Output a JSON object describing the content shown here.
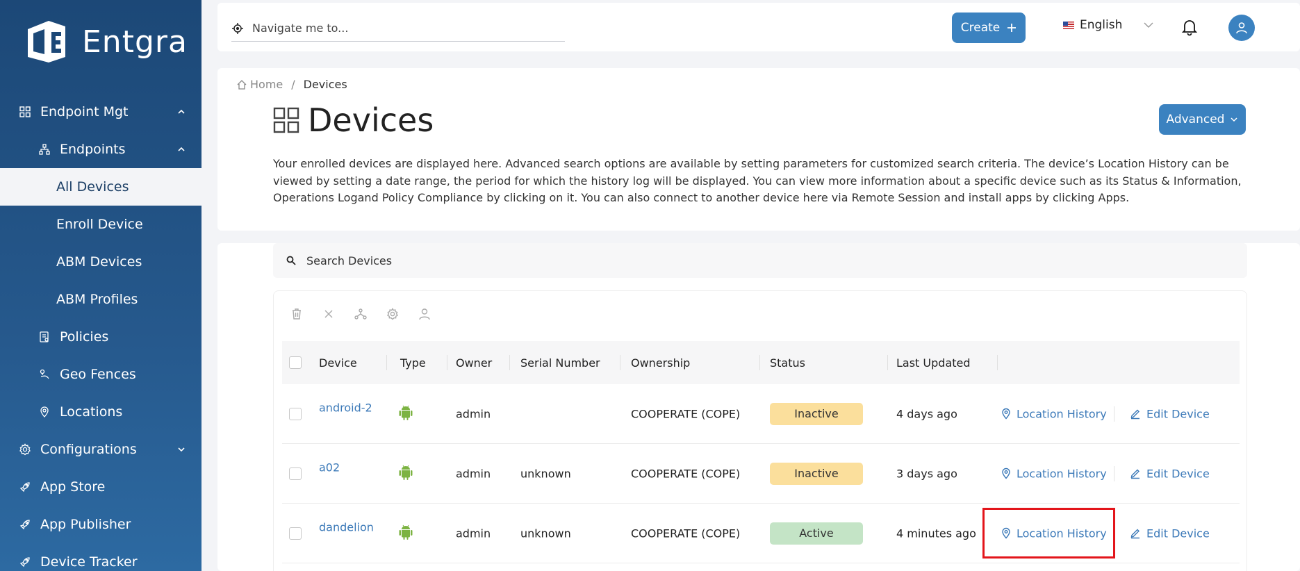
{
  "brand": {
    "name": "Entgra"
  },
  "sidebar": {
    "items": [
      {
        "label": "Endpoint Mgt",
        "icon": "grid-icon",
        "level": 0,
        "expanded": true
      },
      {
        "label": "Endpoints",
        "icon": "hierarchy-icon",
        "level": 1,
        "expanded": true
      },
      {
        "label": "All Devices",
        "level": 2,
        "active": true
      },
      {
        "label": "Enroll Device",
        "level": 2
      },
      {
        "label": "ABM Devices",
        "level": 2
      },
      {
        "label": "ABM Profiles",
        "level": 2
      },
      {
        "label": "Policies",
        "icon": "policy-icon",
        "level": 1
      },
      {
        "label": "Geo Fences",
        "icon": "geofence-icon",
        "level": 1
      },
      {
        "label": "Locations",
        "icon": "location-pin-icon",
        "level": 1
      },
      {
        "label": "Configurations",
        "icon": "gear-icon",
        "level": 0,
        "expanded": false
      },
      {
        "label": "App Store",
        "icon": "rocket-icon",
        "level": 0
      },
      {
        "label": "App Publisher",
        "icon": "rocket-icon",
        "level": 0
      },
      {
        "label": "Device Tracker",
        "icon": "rocket-icon",
        "level": 0
      }
    ]
  },
  "topbar": {
    "nav_placeholder": "Navigate me to...",
    "create_label": "Create",
    "language": "English"
  },
  "breadcrumb": {
    "home": "Home",
    "separator": "/",
    "current": "Devices"
  },
  "page": {
    "title": "Devices",
    "advanced_label": "Advanced",
    "description": "Your enrolled devices are displayed here. Advanced search options are available by setting parameters for customized search criteria. The device’s Location History can be viewed by setting a date range, the period for which the history log will be displayed. You can view more information about a specific device such as its Status & Information, Operations Logand Policy Compliance by clicking on it. You can also connect to another device here via Remote Session and install apps by clicking Apps."
  },
  "search": {
    "placeholder": "Search Devices"
  },
  "table": {
    "headers": {
      "device": "Device",
      "type": "Type",
      "owner": "Owner",
      "serial": "Serial Number",
      "ownership": "Ownership",
      "status": "Status",
      "updated": "Last Updated"
    },
    "rows": [
      {
        "device": "android-2",
        "type": "android",
        "owner": "admin",
        "serial": "",
        "ownership": "COOPERATE (COPE)",
        "status": "Inactive",
        "updated": "4 days ago",
        "loc_label": "Location History",
        "edit_label": "Edit Device"
      },
      {
        "device": "a02",
        "type": "android",
        "owner": "admin",
        "serial": "unknown",
        "ownership": "COOPERATE (COPE)",
        "status": "Inactive",
        "updated": "3 days ago",
        "loc_label": "Location History",
        "edit_label": "Edit Device"
      },
      {
        "device": "dandelion",
        "type": "android",
        "owner": "admin",
        "serial": "unknown",
        "ownership": "COOPERATE (COPE)",
        "status": "Active",
        "updated": "4 minutes ago",
        "loc_label": "Location History",
        "edit_label": "Edit Device"
      }
    ]
  },
  "colors": {
    "accent": "#3b82c0",
    "link": "#3b79b8",
    "inactive": "#fbdf9c",
    "active": "#c4e4c6",
    "highlight": "#e3151b"
  }
}
